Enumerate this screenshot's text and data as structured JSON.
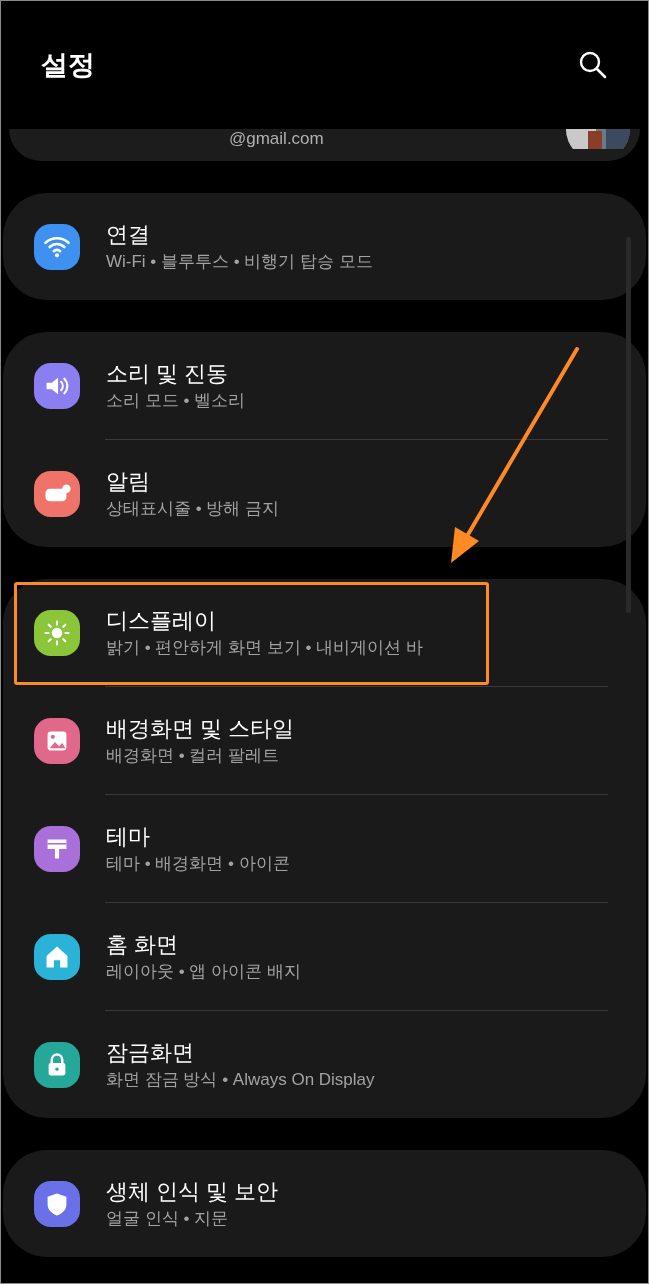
{
  "header": {
    "title": "설정"
  },
  "account": {
    "email": "@gmail.com"
  },
  "sections": [
    {
      "items": [
        {
          "title": "연결",
          "subtitle": "Wi-Fi • 블루투스 • 비행기 탑승 모드",
          "color": "#3e91f0",
          "highlighted": false
        }
      ]
    },
    {
      "items": [
        {
          "title": "소리 및 진동",
          "subtitle": "소리 모드 • 벨소리",
          "color": "#8b7ef0",
          "highlighted": false
        },
        {
          "title": "알림",
          "subtitle": "상태표시줄 • 방해 금지",
          "color": "#ef7368",
          "highlighted": false
        }
      ]
    },
    {
      "items": [
        {
          "title": "디스플레이",
          "subtitle": "밝기 • 편안하게 화면 보기 • 내비게이션 바",
          "color": "#8ac53a",
          "highlighted": true
        },
        {
          "title": "배경화면 및 스타일",
          "subtitle": "배경화면 • 컬러 팔레트",
          "color": "#e0688a",
          "highlighted": false
        },
        {
          "title": "테마",
          "subtitle": "테마 • 배경화면 • 아이콘",
          "color": "#a870d8",
          "highlighted": false
        },
        {
          "title": "홈 화면",
          "subtitle": "레이아웃 • 앱 아이콘 배지",
          "color": "#2ab3d6",
          "highlighted": false
        },
        {
          "title": "잠금화면",
          "subtitle": "화면 잠금 방식 • Always On Display",
          "color": "#25a89a",
          "highlighted": false
        }
      ]
    },
    {
      "items": [
        {
          "title": "생체 인식 및 보안",
          "subtitle": "얼굴 인식 • 지문",
          "color": "#6a70e8",
          "highlighted": false
        }
      ]
    }
  ]
}
